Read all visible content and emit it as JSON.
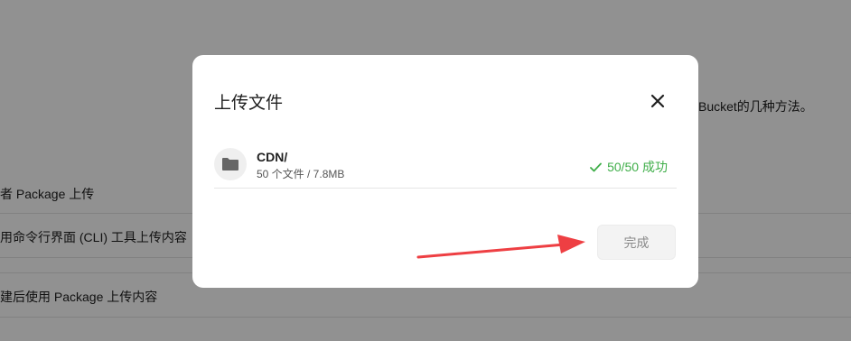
{
  "background": {
    "intro_tail": "Bucket的几种方法。",
    "items": [
      "者 Package 上传",
      "用命令行界面 (CLI) 工具上传内容",
      "建后使用 Package 上传内容"
    ]
  },
  "modal": {
    "title": "上传文件",
    "file": {
      "name": "CDN/",
      "meta": "50 个文件 / 7.8MB",
      "status": "50/50 成功"
    },
    "done_label": "完成"
  },
  "colors": {
    "success": "#3fae49",
    "arrow": "#ee3f43"
  }
}
